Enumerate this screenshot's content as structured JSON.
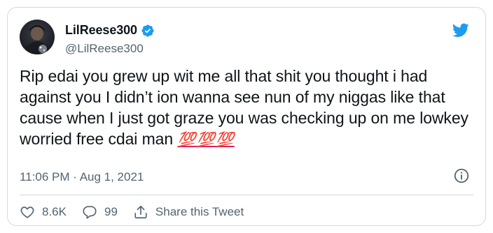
{
  "author": {
    "display_name": "LilReese300",
    "handle": "@LilReese300",
    "verified": true
  },
  "tweet": {
    "text": "Rip edai you grew up wit me all that shit you thought i had against you I didn’t ion wanna see nun of my niggas like that cause when I just got graze you was checking up on me lowkey worried free cdai man ",
    "emoji": "💯💯💯",
    "time": "11:06 PM",
    "separator": " · ",
    "date": "Aug 1, 2021"
  },
  "actions": {
    "likes": "8.6K",
    "replies": "99",
    "share_label": "Share this Tweet"
  },
  "icons": {
    "brand": "twitter-bird-icon",
    "verified": "verified-badge-icon",
    "info": "info-icon",
    "like": "heart-icon",
    "reply": "reply-bubble-icon",
    "share": "share-icon"
  },
  "colors": {
    "brand_blue": "#1d9bf0",
    "text": "#0f1419",
    "muted": "#536471",
    "border": "#cfd9de",
    "emoji_red": "#e0245e"
  }
}
